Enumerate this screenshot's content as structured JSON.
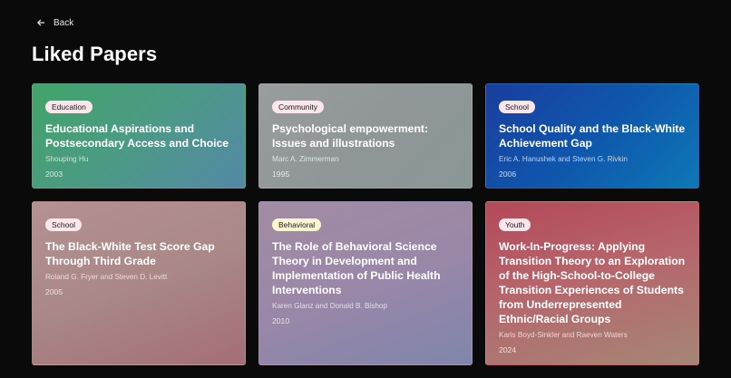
{
  "nav": {
    "back_label": "Back",
    "back_icon": "arrow-left-icon"
  },
  "page": {
    "title": "Liked Papers"
  },
  "colors": {
    "background": "#0a0a0b",
    "badge_pink": "#fbe6ec",
    "badge_yellow": "#fbf5d0"
  },
  "papers": [
    {
      "tag": "Education",
      "title": "Educational Aspirations and Postsecondary Access and Choice",
      "authors": "Shouping Hu",
      "year": "2003"
    },
    {
      "tag": "Community",
      "title": "Psychological empowerment: Issues and illustrations",
      "authors": "Marc A. Zimmerman",
      "year": "1995"
    },
    {
      "tag": "School",
      "title": "School Quality and the Black-White Achievement Gap",
      "authors": "Eric A. Hanushek and Steven G. Rivkin",
      "year": "2006"
    },
    {
      "tag": "School",
      "title": "The Black-White Test Score Gap Through Third Grade",
      "authors": "Roland G. Fryer and Steven D. Levitt",
      "year": "2005"
    },
    {
      "tag": "Behavioral",
      "title": "The Role of Behavioral Science Theory in Development and Implementation of Public Health Interventions",
      "authors": "Karen Glanz and Donald B. Bishop",
      "year": "2010"
    },
    {
      "tag": "Youth",
      "title": "Work-In-Progress: Applying Transition Theory to an Exploration of the High-School-to-College Transition Experiences of Students from Underrepresented Ethnic/Racial Groups",
      "authors": "Karis Boyd-Sinkler and Raeven Waters",
      "year": "2024"
    }
  ]
}
